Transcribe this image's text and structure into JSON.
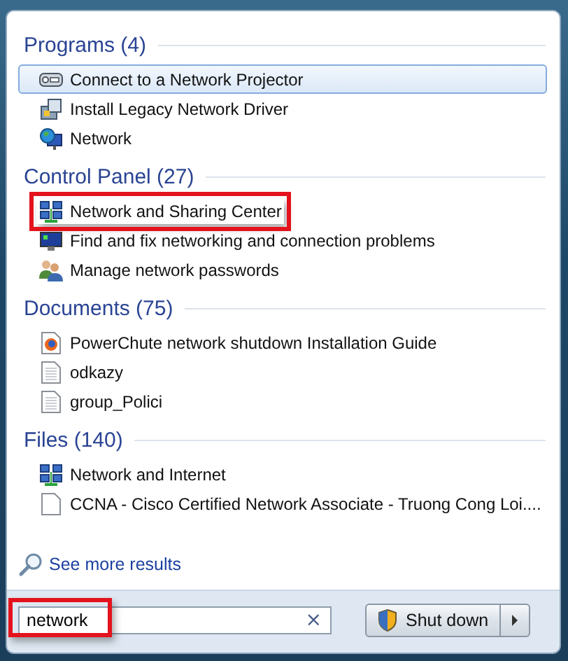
{
  "groups": [
    {
      "title": "Programs (4)",
      "items": [
        {
          "label": "Connect to a Network Projector",
          "kind": "projector",
          "selected": true,
          "highlighted": false
        },
        {
          "label": "Install Legacy Network Driver",
          "kind": "installer",
          "selected": false,
          "highlighted": false
        },
        {
          "label": "Network",
          "kind": "globe",
          "selected": false,
          "highlighted": false
        }
      ]
    },
    {
      "title": "Control Panel (27)",
      "items": [
        {
          "label": "Network and Sharing Center",
          "kind": "network",
          "selected": false,
          "highlighted": true
        },
        {
          "label": "Find and fix networking and connection problems",
          "kind": "monitor",
          "selected": false,
          "highlighted": false
        },
        {
          "label": "Manage network passwords",
          "kind": "users",
          "selected": false,
          "highlighted": false
        }
      ]
    },
    {
      "title": "Documents (75)",
      "items": [
        {
          "label": "PowerChute network shutdown Installation Guide",
          "kind": "browser",
          "selected": false,
          "highlighted": false
        },
        {
          "label": "odkazy",
          "kind": "textfile",
          "selected": false,
          "highlighted": false
        },
        {
          "label": "group_Polici",
          "kind": "textfile",
          "selected": false,
          "highlighted": false
        }
      ]
    },
    {
      "title": "Files (140)",
      "items": [
        {
          "label": "Network and Internet",
          "kind": "network",
          "selected": false,
          "highlighted": false
        },
        {
          "label": "CCNA - Cisco Certified Network Associate - Truong Cong Loi....",
          "kind": "file",
          "selected": false,
          "highlighted": false
        }
      ]
    }
  ],
  "see_more": "See more results",
  "search": {
    "value": "network",
    "highlighted": true,
    "clear": "×"
  },
  "shutdown": {
    "label": "Shut down"
  }
}
